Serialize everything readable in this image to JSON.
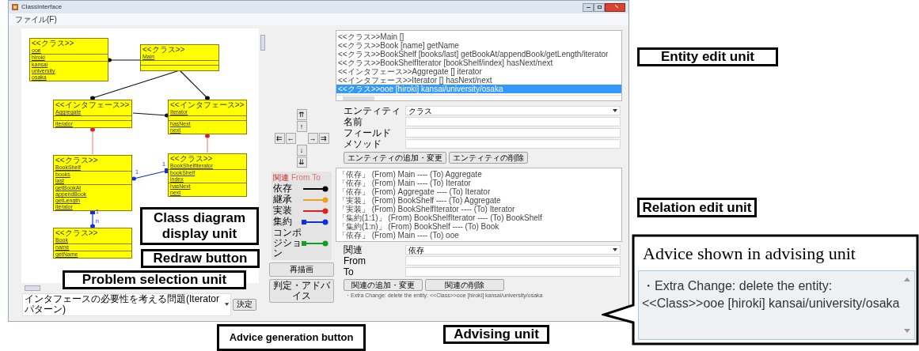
{
  "window": {
    "title": "ClassInterface",
    "menu": [
      "ファイル(F)"
    ]
  },
  "diagram": {
    "classes": [
      {
        "stereotype": "<<クラス>>",
        "name": "ooe",
        "fields": [
          "hiroki"
        ],
        "methods": [
          "kansai",
          "university",
          "osaka"
        ]
      },
      {
        "stereotype": "<<クラス>>",
        "name": "Main"
      },
      {
        "stereotype": "<<インタフェース>>",
        "name": "Aggregate",
        "methods": [
          "iterator"
        ]
      },
      {
        "stereotype": "<<インタフェース>>",
        "name": "Iterator",
        "methods": [
          "hasNext",
          "next"
        ]
      },
      {
        "stereotype": "<<クラス>>",
        "name": "BookShelf",
        "fields": [
          "books",
          "last"
        ],
        "methods": [
          "getBookAt",
          "appendBook",
          "getLength",
          "iterator"
        ]
      },
      {
        "stereotype": "<<クラス>>",
        "name": "BookShelfIterator",
        "fields": [
          "bookShelf",
          "index"
        ],
        "methods": [
          "hasNext",
          "next"
        ]
      },
      {
        "stereotype": "<<クラス>>",
        "name": "Book",
        "fields": [
          "name"
        ],
        "methods": [
          "getName"
        ]
      }
    ],
    "relations": [
      {
        "kind": "dependency"
      },
      {
        "kind": "dependency"
      },
      {
        "kind": "dependency"
      },
      {
        "kind": "dependency"
      },
      {
        "kind": "realization"
      },
      {
        "kind": "realization"
      },
      {
        "kind": "aggregation",
        "labels": [
          "1",
          "1"
        ]
      },
      {
        "kind": "aggregation",
        "labels": [
          "1",
          "n"
        ]
      }
    ]
  },
  "problem": {
    "value": "インタフェースの必要性を考える問題(Iteratorパターン)",
    "button": "決定"
  },
  "entity_list": [
    {
      "text": "<<クラス>>Main []",
      "selected": false
    },
    {
      "text": "<<クラス>>Book [name] getName",
      "selected": false
    },
    {
      "text": "<<クラス>>BookShelf [books/last] getBookAt/appendBook/getLength/iterator",
      "selected": false
    },
    {
      "text": "<<クラス>>BookShelfIterator [bookShelf/index] hasNext/next",
      "selected": false
    },
    {
      "text": "<<インタフェース>>Aggregate [] iterator",
      "selected": false
    },
    {
      "text": "<<インタフェース>>Iterator [] hasNext/next",
      "selected": false
    },
    {
      "text": "<<クラス>>ooe [hiroki] kansai/university/osaka",
      "selected": true
    }
  ],
  "arrow_pad": [
    "⇈",
    "↑",
    "⇇",
    "←",
    "→",
    "⇉",
    "↓",
    "⇊"
  ],
  "entity_form": {
    "type_label": "エンティティ",
    "type_value": "クラス",
    "fields": [
      {
        "label": "名前"
      },
      {
        "label": "フィールド"
      },
      {
        "label": "メソッド"
      }
    ],
    "buttons": [
      "エンティティの追加・変更",
      "エンティティの削除"
    ]
  },
  "legend": {
    "header": [
      "関連",
      "From",
      "To"
    ],
    "items": [
      {
        "label": "依存",
        "kind": "dependency",
        "color": "#000000"
      },
      {
        "label": "継承",
        "kind": "inheritance",
        "color": "#f0a020"
      },
      {
        "label": "実装",
        "kind": "realization",
        "color": "#e02020"
      },
      {
        "label": "集約",
        "kind": "aggregation",
        "color": "#1030e0"
      },
      {
        "label": "コンポジション",
        "kind": "composition",
        "color": "#10a020"
      }
    ]
  },
  "relation_list": [
    "「依存」 (From) Main ---- (To) Aggregate",
    "「依存」 (From) Main ---- (To) Iterator",
    "「依存」 (From) Aggregate ---- (To) Iterator",
    "「実装」 (From) BookShelf ---- (To) Aggregate",
    "「実装」 (From) BookShelfIterator ---- (To) Iterator",
    "「集約(1:1)」 (From) BookShelfIterator ---- (To) BookShelf",
    "「集約(1:n)」 (From) BookShelf ---- (To) Book",
    "「依存」 (From) Main ---- (To) ooe"
  ],
  "relation_form": {
    "type_label": "関連",
    "type_value": "依存",
    "fields": [
      {
        "label": "From"
      },
      {
        "label": "To"
      }
    ],
    "buttons": [
      "関連の追加・変更",
      "関連の削除"
    ]
  },
  "redraw_button": "再描画",
  "advice_button": "判定・アドバイス",
  "advice": "・Extra Change: delete the entity: <<Class>>ooe [hiroki] kansai/university/osaka",
  "callouts": [
    {
      "text": "Entity edit unit"
    },
    {
      "text": "Class diagram display unit"
    },
    {
      "text": "Relation edit unit"
    },
    {
      "text": "Redraw button"
    },
    {
      "text": "Problem selection unit"
    },
    {
      "text": "Advice generation button"
    },
    {
      "text": "Advising unit"
    }
  ],
  "advice_callout": {
    "title": "Advice shown in advising unit",
    "text": "・Extra Change: delete the entity: <<Class>>ooe [hiroki] kansai/university/osaka"
  }
}
